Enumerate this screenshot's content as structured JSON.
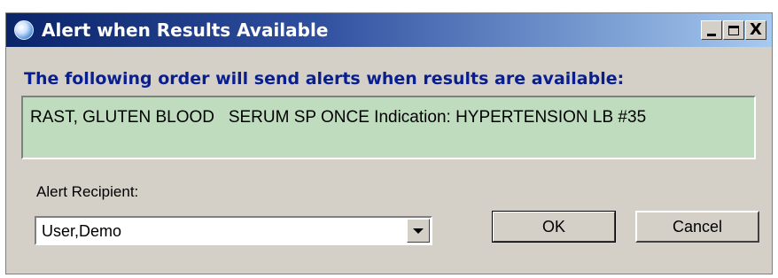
{
  "window": {
    "title": "Alert when Results Available",
    "controls": {
      "minimize": "_",
      "maximize": "□",
      "close": "X"
    }
  },
  "heading": "The following order will send alerts when results are available:",
  "order": {
    "text": "RAST, GLUTEN BLOOD   SERUM SP ONCE Indication: HYPERTENSION LB #35",
    "background_color": "#bfdcbf"
  },
  "recipient": {
    "label": "Alert Recipient:",
    "selected": "User,Demo"
  },
  "buttons": {
    "ok": "OK",
    "cancel": "Cancel"
  },
  "colors": {
    "titlebar_start": "#0a246a",
    "titlebar_end": "#a6caf0",
    "heading": "#0a1f8f",
    "dialog_bg": "#d4d0c8"
  }
}
